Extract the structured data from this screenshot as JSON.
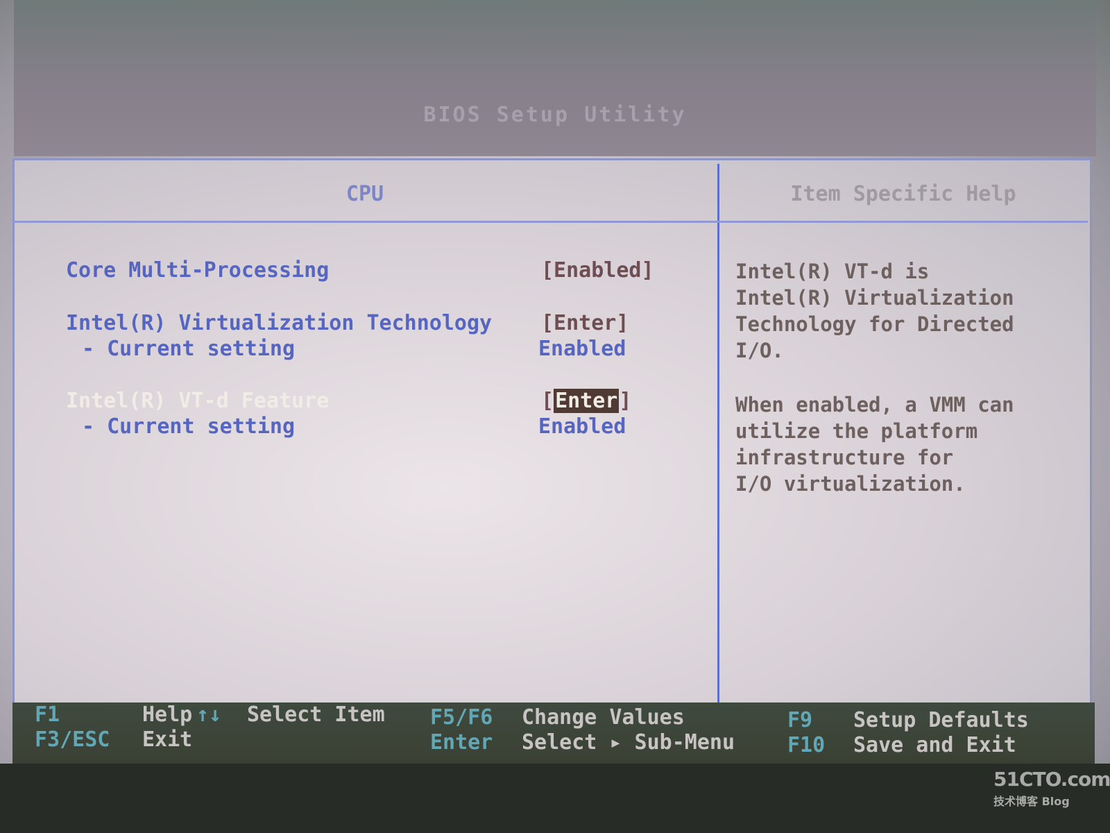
{
  "window": {
    "title": "BIOS Setup Utility"
  },
  "panels": {
    "left_header": "CPU",
    "right_header": "Item Specific Help"
  },
  "settings": [
    {
      "label": "Core Multi-Processing",
      "value": "[Enabled]"
    },
    {
      "label": "Intel(R) Virtualization Technology",
      "value": "[Enter]"
    },
    {
      "label": "- Current setting",
      "value": "Enabled"
    },
    {
      "label": "Intel(R) VT-d Feature",
      "value_open": "[",
      "value_highlight": "Enter",
      "value_close": "]",
      "selected": true
    },
    {
      "label": "- Current setting",
      "value": "Enabled"
    }
  ],
  "help": {
    "paragraph1": "Intel(R) VT-d is\nIntel(R) Virtualization\nTechnology for Directed\nI/O.",
    "paragraph2": "When enabled, a VMM can\nutilize the platform\ninfrastructure for\nI/O virtualization."
  },
  "footer": {
    "keys": [
      {
        "key": "F1",
        "desc": "Help"
      },
      {
        "key": "↑↓",
        "desc": "Select Item"
      },
      {
        "key": "F5/F6",
        "desc": "Change Values"
      },
      {
        "key": "F9",
        "desc": "Setup Defaults"
      },
      {
        "key": "F3/ESC",
        "desc": "Exit"
      },
      {
        "key": "Enter",
        "desc": "Select ▸ Sub-Menu"
      },
      {
        "key": "F10",
        "desc": "Save and Exit"
      }
    ]
  },
  "watermark": {
    "main": "51CTO.com",
    "sub": "技术博客  Blog"
  }
}
